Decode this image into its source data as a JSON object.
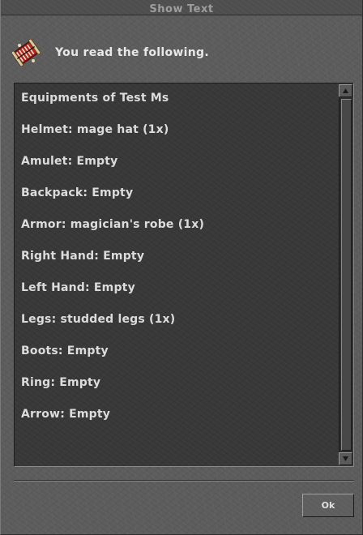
{
  "window": {
    "title": "Show Text"
  },
  "header": {
    "icon": "scroll-icon",
    "text": "You read the following."
  },
  "content": {
    "lines": [
      "Equipments of Test Ms",
      "Helmet: mage hat (1x)",
      "Amulet: Empty",
      "Backpack: Empty",
      "Armor: magician's robe (1x)",
      "Right Hand: Empty",
      "Left Hand: Empty",
      "Legs: studded legs (1x)",
      "Boots: Empty",
      "Ring: Empty",
      "Arrow: Empty"
    ]
  },
  "scrollbar": {
    "up_icon": "arrow-up-icon",
    "down_icon": "arrow-down-icon"
  },
  "buttons": {
    "ok_label": "Ok"
  },
  "colors": {
    "window_bg": "#5c5c5c",
    "text_area_bg": "#383838",
    "text": "#dcdcdc",
    "title_text": "#9e9e9e"
  }
}
